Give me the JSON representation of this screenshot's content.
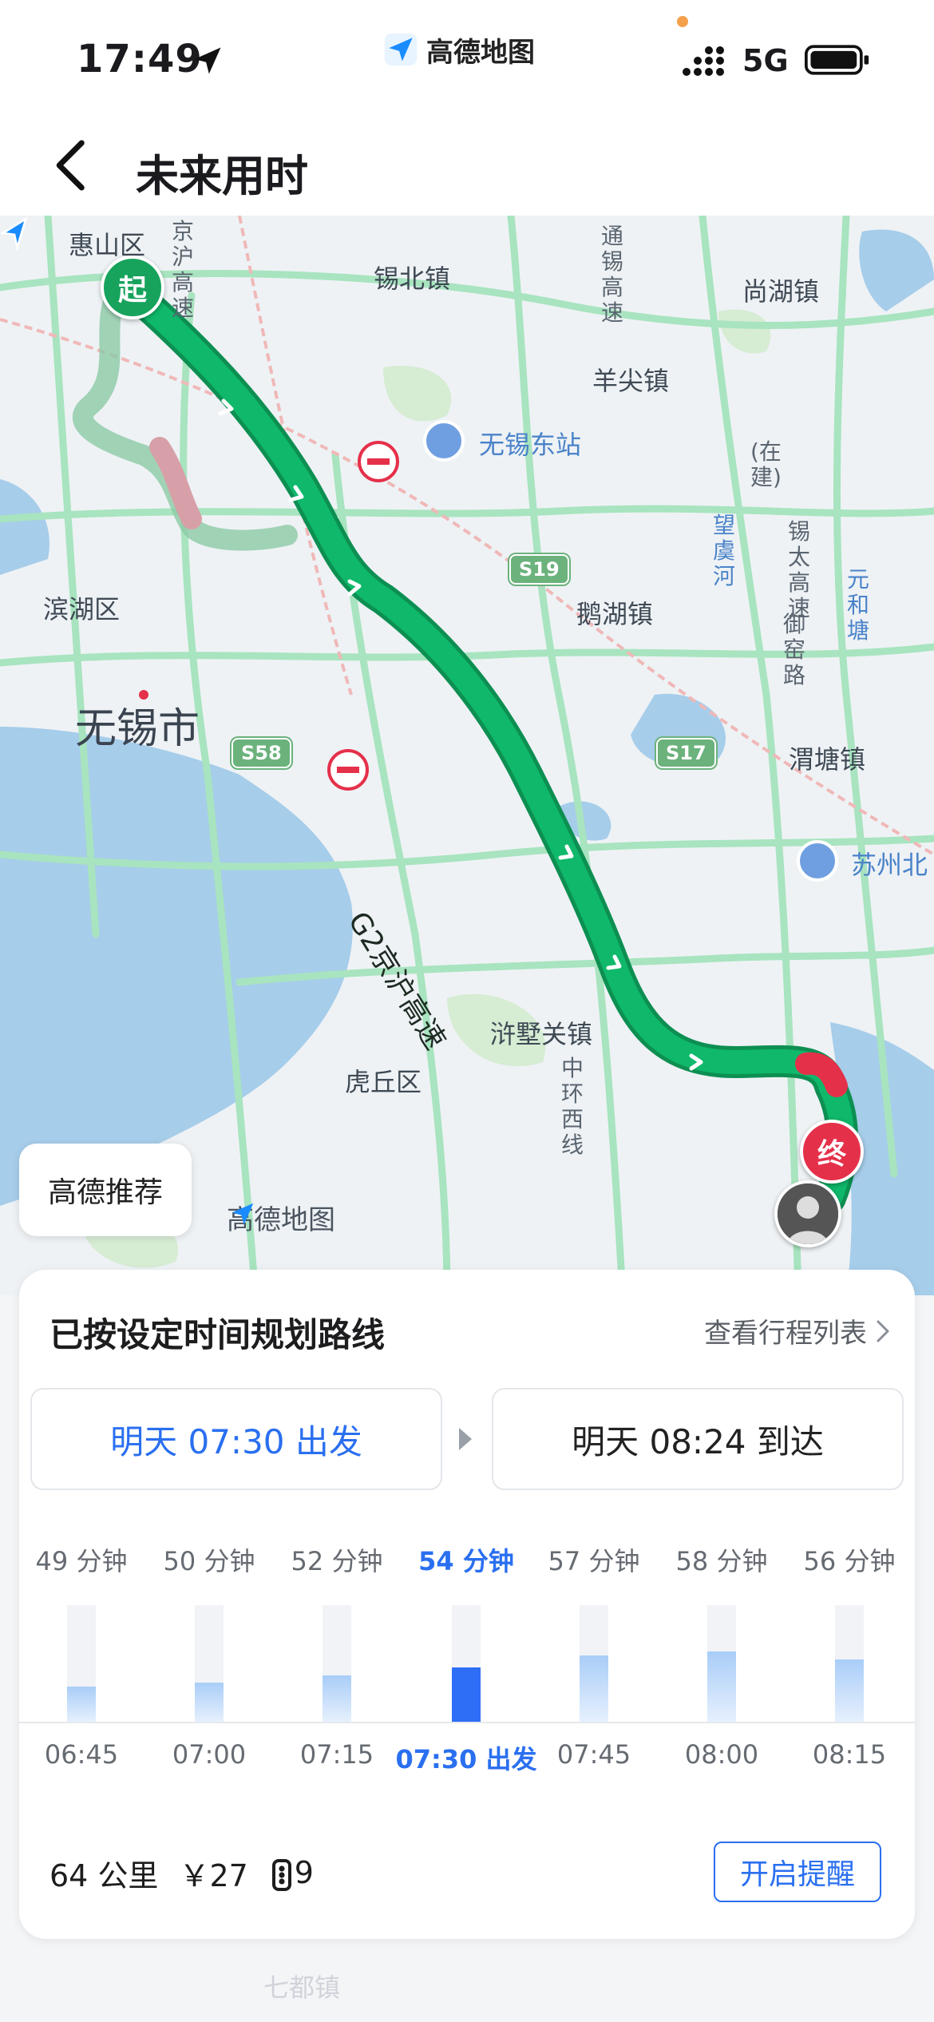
{
  "status_bar": {
    "time": "17:49",
    "app_name": "高德地图",
    "network": "5G"
  },
  "header": {
    "title": "未来用时"
  },
  "map": {
    "labels": {
      "huishan": "惠山区",
      "xibei": "锡北镇",
      "shanghu": "尚湖镇",
      "yangjian": "羊尖镇",
      "wuxi_east": "无锡东站",
      "binhu": "滨湖区",
      "wuxi_city": "无锡市",
      "ehu": "鹅湖镇",
      "weitang": "渭塘镇",
      "suzhou_north": "苏州北",
      "xushuguan": "浒墅关镇",
      "huqiu": "虎丘区",
      "route_name": "G2京沪高速"
    },
    "vertical_labels": {
      "jinghu": "京沪高速",
      "tongxi": "通锡高速",
      "wangyu": "望虞河",
      "yumin": "御窑路",
      "yuanhe": "元和塘",
      "zhonghuan": "中环西线",
      "zaijian": "(在建)",
      "xida": "锡太高速"
    },
    "shields": {
      "s19": "S19",
      "s58": "S58",
      "s17": "S17"
    },
    "start_pin": "起",
    "end_pin": "终",
    "recommend": "高德推荐",
    "watermark": "高德地图",
    "colors": {
      "route": "#0fb86a",
      "congested": "#e5304a",
      "road": "#a8e4bf",
      "water": "#a6cdea"
    }
  },
  "card": {
    "title": "已按设定时间规划路线",
    "itinerary_link": "查看行程列表",
    "depart": "明天 07:30 出发",
    "arrive": "明天 08:24 到达",
    "options": [
      {
        "duration": "49 分钟",
        "slot": "06:45",
        "minutes": 49,
        "active": false
      },
      {
        "duration": "50 分钟",
        "slot": "07:00",
        "minutes": 50,
        "active": false
      },
      {
        "duration": "52 分钟",
        "slot": "07:15",
        "minutes": 52,
        "active": false
      },
      {
        "duration": "54 分钟",
        "slot": "07:30 出发",
        "minutes": 54,
        "active": true
      },
      {
        "duration": "57 分钟",
        "slot": "07:45",
        "minutes": 57,
        "active": false
      },
      {
        "duration": "58 分钟",
        "slot": "08:00",
        "minutes": 58,
        "active": false
      },
      {
        "duration": "56 分钟",
        "slot": "08:15",
        "minutes": 56,
        "active": false
      }
    ],
    "distance": "64 公里",
    "toll": "￥27",
    "traffic_lights": "9",
    "remind_button": "开启提醒",
    "accent": "#2a6ff0"
  },
  "bottom_hint": "七都镇"
}
